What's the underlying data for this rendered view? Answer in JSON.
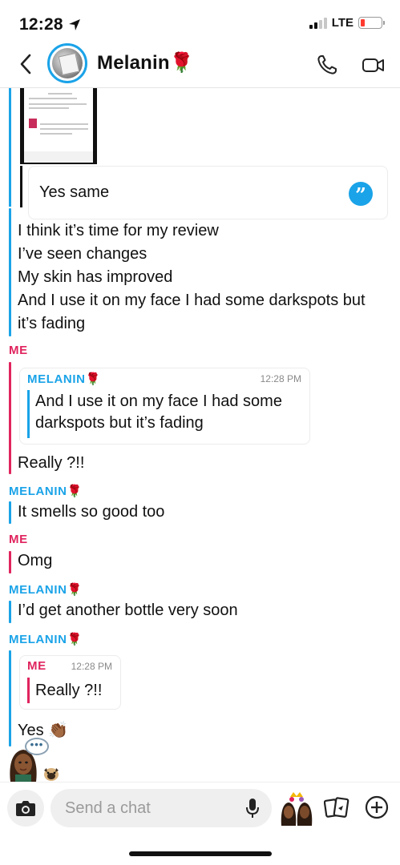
{
  "status_bar": {
    "time": "12:28",
    "network": "LTE"
  },
  "header": {
    "contact_name": "Melanin",
    "name_emoji": "🌹"
  },
  "quoted_media": {
    "reply_text": "Yes same"
  },
  "messages_block_1": {
    "lines": [
      "I think it’s time for my review",
      "I’ve seen changes",
      "My skin has improved",
      "And I use it on my face I had some darkspots but",
      "it’s fading"
    ]
  },
  "me_label": "ME",
  "them_label": "MELANIN",
  "reply_1": {
    "quoted_sender": "MELANIN",
    "time": "12:28 PM",
    "quoted_lines": [
      "And I use it on my face I had some",
      "darkspots but it’s fading"
    ],
    "message": "Really ?!!"
  },
  "msg_2": "It smells so good too",
  "msg_3": "Omg",
  "msg_4": "I’d get another bottle very soon",
  "reply_2": {
    "quoted_sender": "ME",
    "time": "12:28 PM",
    "quoted_text": "Really ?!!",
    "message": "Yes",
    "emoji": "👏🏾"
  },
  "typing_indicator": "•••",
  "composer": {
    "placeholder": "Send a chat"
  },
  "colors": {
    "me": "#e0245e",
    "them": "#1aa3e8"
  },
  "icons": [
    "location-arrow-icon",
    "back-chevron-icon",
    "phone-icon",
    "video-icon",
    "quote-reply-icon",
    "camera-icon",
    "microphone-icon",
    "bitmoji-icon",
    "cards-icon",
    "plus-icon"
  ]
}
